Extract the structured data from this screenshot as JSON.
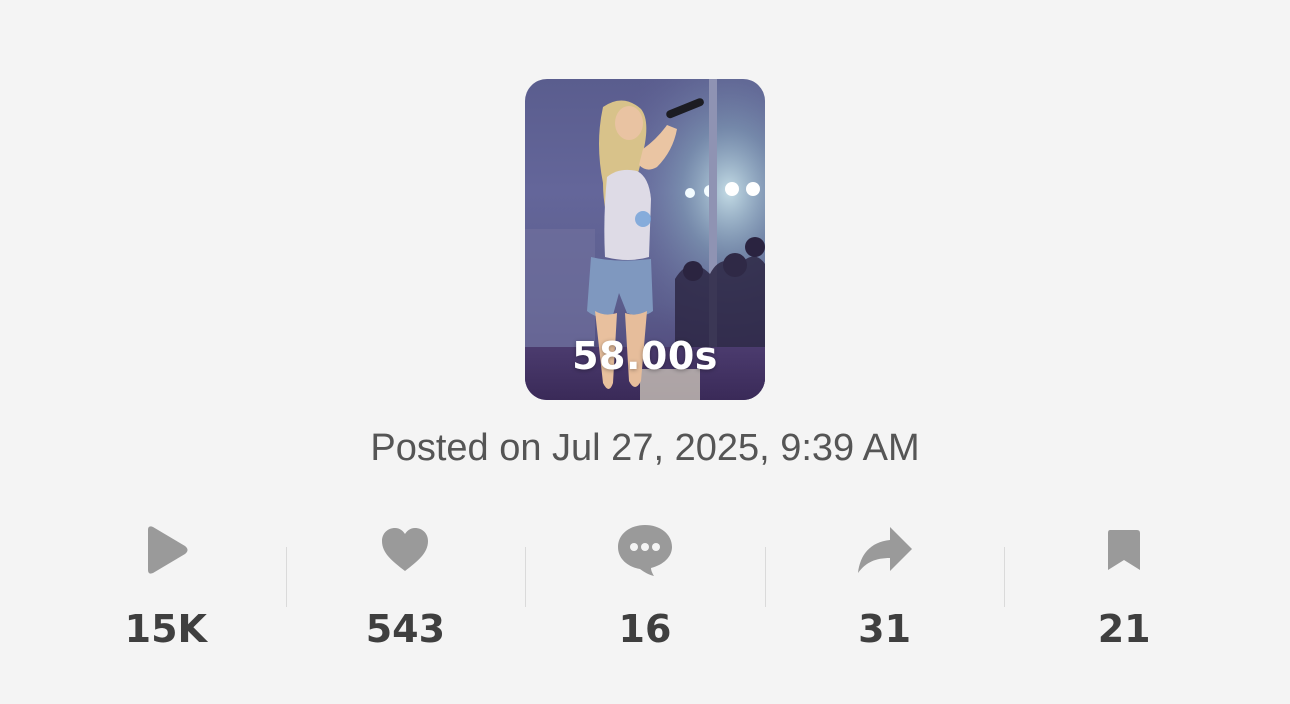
{
  "video": {
    "thumbnail_alt": "Performer singing on stage",
    "duration": "58.00s"
  },
  "posted": "Posted on Jul 27, 2025, 9:39 AM",
  "stats": [
    {
      "name": "views",
      "icon": "play-icon",
      "value": "15K"
    },
    {
      "name": "likes",
      "icon": "heart-icon",
      "value": "543"
    },
    {
      "name": "comments",
      "icon": "comment-icon",
      "value": "16"
    },
    {
      "name": "shares",
      "icon": "share-icon",
      "value": "31"
    },
    {
      "name": "saves",
      "icon": "bookmark-icon",
      "value": "21"
    }
  ],
  "colors": {
    "background": "#f4f4f4",
    "icon": "#9a9a9a",
    "value_text": "#3f3f3f",
    "posted_text": "#555555"
  }
}
